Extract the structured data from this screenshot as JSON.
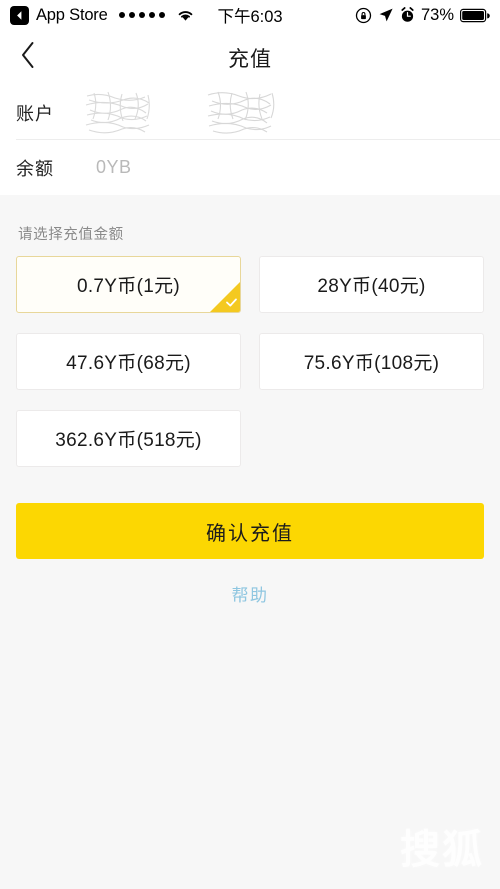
{
  "statusbar": {
    "back_app_label": "App Store",
    "signal_dots": 5,
    "wifi_icon": "wifi-icon",
    "time": "下午6:03",
    "rotation_lock_icon": "rotation-lock-icon",
    "location_icon": "location-arrow-icon",
    "alarm_icon": "alarm-clock-icon",
    "battery_percent": "73%",
    "battery_icon": "battery-icon"
  },
  "navbar": {
    "back_icon": "chevron-left-icon",
    "title": "充值"
  },
  "account": {
    "account_label": "账户",
    "account_value_redacted": "",
    "balance_label": "余额",
    "balance_value": "0YB"
  },
  "amounts": {
    "section_title": "请选择充值金额",
    "options": [
      {
        "label": "0.7Y币(1元)",
        "coins": 0.7,
        "price": 1,
        "selected": true
      },
      {
        "label": "28Y币(40元)",
        "coins": 28,
        "price": 40,
        "selected": false
      },
      {
        "label": "47.6Y币(68元)",
        "coins": 47.6,
        "price": 68,
        "selected": false
      },
      {
        "label": "75.6Y币(108元)",
        "coins": 75.6,
        "price": 108,
        "selected": false
      },
      {
        "label": "362.6Y币(518元)",
        "coins": 362.6,
        "price": 518,
        "selected": false
      }
    ],
    "check_icon": "check-icon"
  },
  "actions": {
    "confirm_label": "确认充值",
    "help_label": "帮助"
  },
  "watermark": {
    "text": "搜狐"
  },
  "colors": {
    "accent_yellow": "#fcd702",
    "selected_border": "#e8d79a",
    "help_blue": "#8ec6e0",
    "page_bg": "#f7f7f7",
    "card_bg": "#ffffff"
  }
}
